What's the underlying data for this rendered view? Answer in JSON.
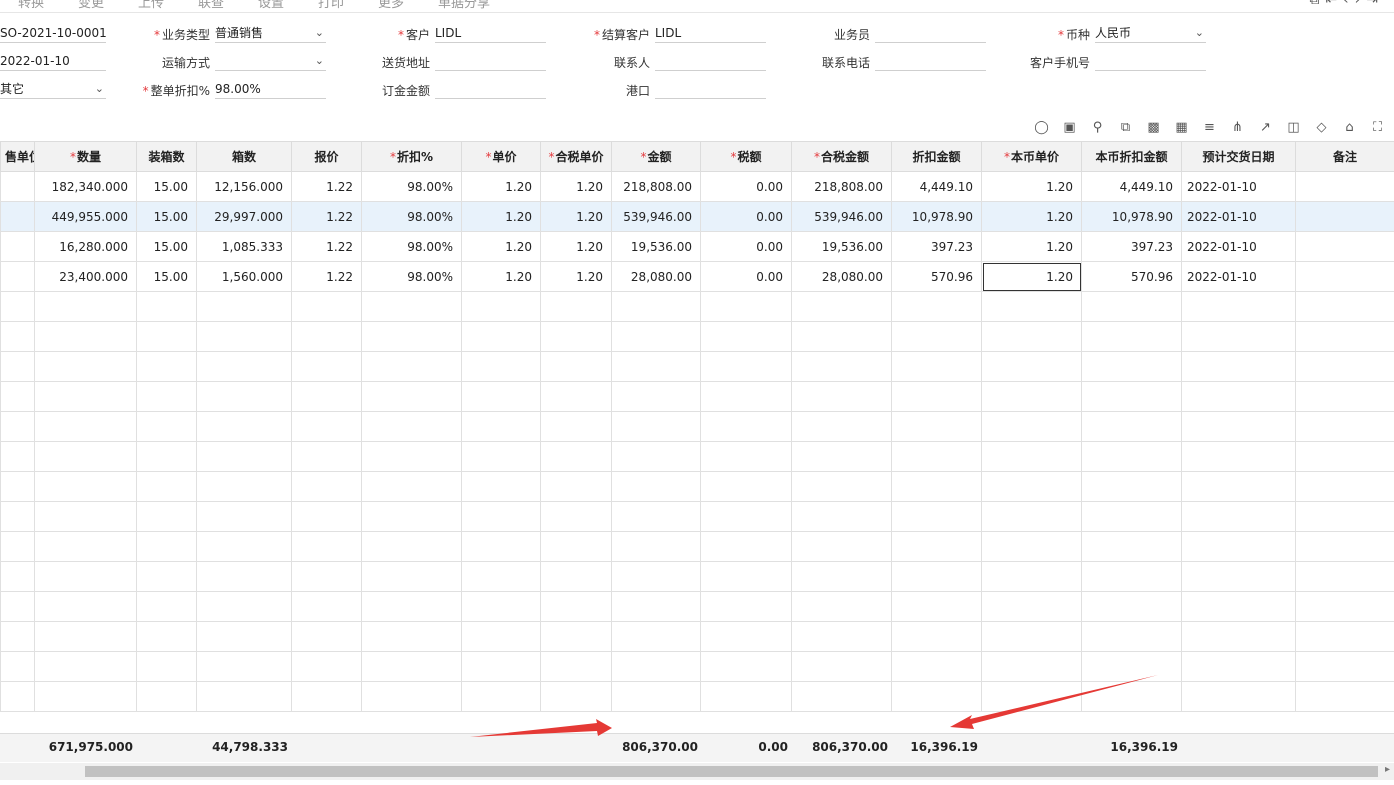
{
  "menu": [
    "转换",
    "变更",
    "上传",
    "联查",
    "设置",
    "打印",
    "更多",
    "单据分享"
  ],
  "nav_glyphs": [
    "⧉",
    "⇤",
    "‹",
    "›",
    "⇥"
  ],
  "form": {
    "order_no": "SO-2021-10-0001",
    "date": "2022-01-10",
    "category": "其它",
    "business_type_label": "业务类型",
    "business_type": "普通销售",
    "transport_label": "运输方式",
    "transport": "",
    "discount_label": "整单折扣%",
    "discount": "98.00%",
    "customer_label": "客户",
    "customer": "LIDL",
    "address_label": "送货地址",
    "address": "",
    "deposit_label": "订金金额",
    "deposit": "",
    "settle_label": "结算客户",
    "settle_customer": "LIDL",
    "contact_label": "联系人",
    "contact": "",
    "port_label": "港口",
    "port": "",
    "salesman_label": "业务员",
    "salesman": "",
    "phone_label": "联系电话",
    "phone": "",
    "currency_label": "币种",
    "currency": "人民币",
    "mobile_label": "客户手机号",
    "mobile": ""
  },
  "toolbar_icons": [
    "lightbulb-icon",
    "scan-icon",
    "location-icon",
    "copy-icon",
    "paste-icon",
    "batch-icon",
    "filter-icon",
    "split-icon",
    "chart-icon",
    "layout-icon",
    "tag-icon",
    "bank-icon",
    "fullscreen-icon"
  ],
  "columns": [
    {
      "label": "售单位",
      "req": false
    },
    {
      "label": "数量",
      "req": true
    },
    {
      "label": "装箱数",
      "req": false
    },
    {
      "label": "箱数",
      "req": false
    },
    {
      "label": "报价",
      "req": false
    },
    {
      "label": "折扣%",
      "req": true
    },
    {
      "label": "单价",
      "req": true
    },
    {
      "label": "合税单价",
      "req": true
    },
    {
      "label": "金额",
      "req": true
    },
    {
      "label": "税额",
      "req": true
    },
    {
      "label": "合税金额",
      "req": true
    },
    {
      "label": "折扣金额",
      "req": false
    },
    {
      "label": "本币单价",
      "req": true
    },
    {
      "label": "本币折扣金额",
      "req": false
    },
    {
      "label": "预计交货日期",
      "req": false
    },
    {
      "label": "备注",
      "req": false
    }
  ],
  "rows": [
    [
      "",
      "182,340.000",
      "15.00",
      "12,156.000",
      "1.22",
      "98.00%",
      "1.20",
      "1.20",
      "218,808.00",
      "0.00",
      "218,808.00",
      "4,449.10",
      "1.20",
      "4,449.10",
      "2022-01-10",
      ""
    ],
    [
      "",
      "449,955.000",
      "15.00",
      "29,997.000",
      "1.22",
      "98.00%",
      "1.20",
      "1.20",
      "539,946.00",
      "0.00",
      "539,946.00",
      "10,978.90",
      "1.20",
      "10,978.90",
      "2022-01-10",
      ""
    ],
    [
      "",
      "16,280.000",
      "15.00",
      "1,085.333",
      "1.22",
      "98.00%",
      "1.20",
      "1.20",
      "19,536.00",
      "0.00",
      "19,536.00",
      "397.23",
      "1.20",
      "397.23",
      "2022-01-10",
      ""
    ],
    [
      "",
      "23,400.000",
      "15.00",
      "1,560.000",
      "1.22",
      "98.00%",
      "1.20",
      "1.20",
      "28,080.00",
      "0.00",
      "28,080.00",
      "570.96",
      "1.20",
      "570.96",
      "2022-01-10",
      ""
    ]
  ],
  "empty_rows": 14,
  "totals": {
    "qty": "671,975.000",
    "boxes": "44,798.333",
    "amount": "806,370.00",
    "tax": "0.00",
    "tax_amount": "806,370.00",
    "discount_amount": "16,396.19",
    "local_discount": "16,396.19"
  },
  "colors": {
    "required": "#e4393c",
    "selected_row": "#e8f2fb",
    "annotation_arrow": "#e53935"
  }
}
